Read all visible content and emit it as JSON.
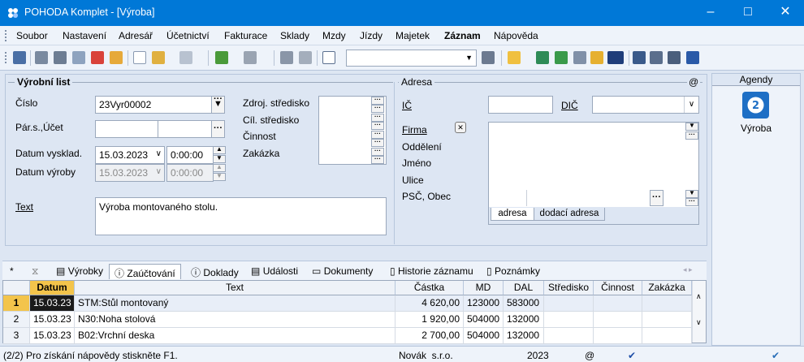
{
  "window": {
    "title": "POHODA Komplet - [Výroba]"
  },
  "menu": [
    "Soubor",
    "Nastavení",
    "Adresář",
    "Účetnictví",
    "Fakturace",
    "Sklady",
    "Mzdy",
    "Jízdy",
    "Majetek",
    "Záznam",
    "Nápověda"
  ],
  "form": {
    "section_title": "Výrobní list",
    "cislo_label": "Číslo",
    "cislo_value": "23Vyr00002",
    "pars_label": "Pár.s.,Účet",
    "datum_vysklad_label": "Datum vysklad.",
    "datum_vysklad_value": "15.03.2023",
    "cas_vysklad_value": "0:00:00",
    "datum_vyroby_label": "Datum výroby",
    "datum_vyroby_value": "15.03.2023",
    "cas_vyroby_value": "0:00:00",
    "text_label": "Text",
    "text_value": "Výroba montovaného stolu.",
    "zdroj_label": "Zdroj. středisko",
    "cil_label": "Cíl. středisko",
    "cinnost_label": "Činnost",
    "zakazka_label": "Zakázka"
  },
  "address": {
    "section_title": "Adresa",
    "at_sign": "@",
    "ic_label": "IČ",
    "dic_label": "DIČ",
    "firma_label": "Firma",
    "oddeleni_label": "Oddělení",
    "jmeno_label": "Jméno",
    "ulice_label": "Ulice",
    "psc_label": "PSČ, Obec",
    "tab_adresa": "adresa",
    "tab_dodaci": "dodací adresa"
  },
  "agendy": {
    "title": "Agendy",
    "item": "Výroba"
  },
  "tabs": [
    "*",
    "",
    "Výrobky",
    "Zaúčtování",
    "Doklady",
    "Události",
    "Dokumenty",
    "Historie záznamu",
    "Poznámky"
  ],
  "grid": {
    "columns": [
      "",
      "Datum",
      "Text",
      "Částka",
      "MD",
      "DAL",
      "Středisko",
      "Činnost",
      "Zakázka"
    ],
    "rows": [
      {
        "n": "1",
        "datum": "15.03.23",
        "text": "STM:Stůl montovaný",
        "castka": "4 620,00",
        "md": "123000",
        "dal": "583000"
      },
      {
        "n": "2",
        "datum": "15.03.23",
        "text": "N30:Noha stolová",
        "castka": "1 920,00",
        "md": "504000",
        "dal": "132000"
      },
      {
        "n": "3",
        "datum": "15.03.23",
        "text": "B02:Vrchní deska",
        "castka": "2 700,00",
        "md": "504000",
        "dal": "132000"
      }
    ]
  },
  "status": {
    "help": "(2/2) Pro získání nápovědy stiskněte F1.",
    "user": "Novák  s.r.o.",
    "year": "2023",
    "at": "@"
  }
}
